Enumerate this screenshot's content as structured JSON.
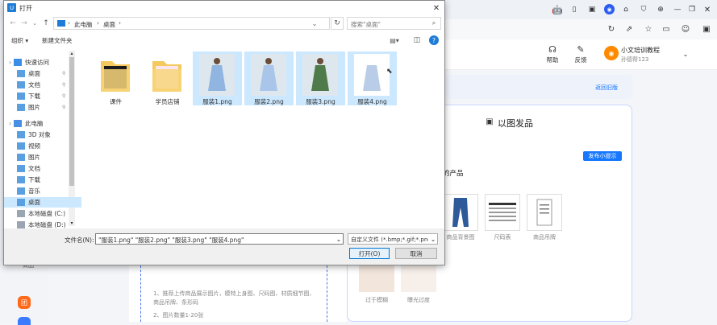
{
  "dialog": {
    "title": "打开",
    "breadcrumb": [
      "此电脑",
      "桌面"
    ],
    "search_placeholder": "搜索\"桌面\"",
    "toolbar": {
      "organize": "组织 ▾",
      "new_folder": "新建文件夹"
    },
    "nav": [
      {
        "label": "快速访问",
        "indent": 0
      },
      {
        "label": "桌面",
        "indent": 1,
        "pin": true
      },
      {
        "label": "文档",
        "indent": 1,
        "pin": true
      },
      {
        "label": "下载",
        "indent": 1,
        "pin": true
      },
      {
        "label": "图片",
        "indent": 1,
        "pin": true
      },
      {
        "label": "此电脑",
        "indent": 0
      },
      {
        "label": "3D 对象",
        "indent": 1
      },
      {
        "label": "视频",
        "indent": 1
      },
      {
        "label": "图片",
        "indent": 1
      },
      {
        "label": "文档",
        "indent": 1
      },
      {
        "label": "下载",
        "indent": 1
      },
      {
        "label": "音乐",
        "indent": 1
      },
      {
        "label": "桌面",
        "indent": 1,
        "selected": true
      },
      {
        "label": "本地磁盘 (C:)",
        "indent": 1
      },
      {
        "label": "本地磁盘 (D:)",
        "indent": 1
      }
    ],
    "files": [
      {
        "name": "课件",
        "kind": "folder",
        "selected": false
      },
      {
        "name": "学员店铺",
        "kind": "folder",
        "selected": false
      },
      {
        "name": "服装1.png",
        "kind": "image",
        "selected": true
      },
      {
        "name": "服装2.png",
        "kind": "image",
        "selected": true
      },
      {
        "name": "服装3.png",
        "kind": "image",
        "selected": true
      },
      {
        "name": "服装4.png",
        "kind": "image",
        "selected": true
      }
    ],
    "filename_label": "文件名(N):",
    "filename_value": "\"服装1.png\" \"服装2.png\" \"服装3.png\" \"服装4.png\"",
    "filetype_value": "自定义文件 (*.bmp;*.gif;*.png",
    "open_button": "打开(O)",
    "cancel_button": "取消"
  },
  "app": {
    "help": "帮助",
    "feedback": "反馈",
    "user_name": "小文培训教程",
    "user_sub": "孙德帮123",
    "back_old": "返回旧版",
    "section_title": "以图发品",
    "tip_badge": "发布小提示",
    "partial_label": "的产品",
    "categories": [
      "商品背景图",
      "尺码表",
      "商品吊牌"
    ],
    "effects": [
      "过于模糊",
      "曝光过度"
    ],
    "upload_tips": [
      "1、推荐上传商品展示图片，模特上身图、尺码图、材质细节图、",
      "商品吊牌、条形码",
      "2、图片数量1-20张"
    ],
    "side_label": "商品"
  },
  "colors": {
    "accent": "#1677ff",
    "selection": "#cce8ff",
    "orange": "#ff6a1a"
  }
}
